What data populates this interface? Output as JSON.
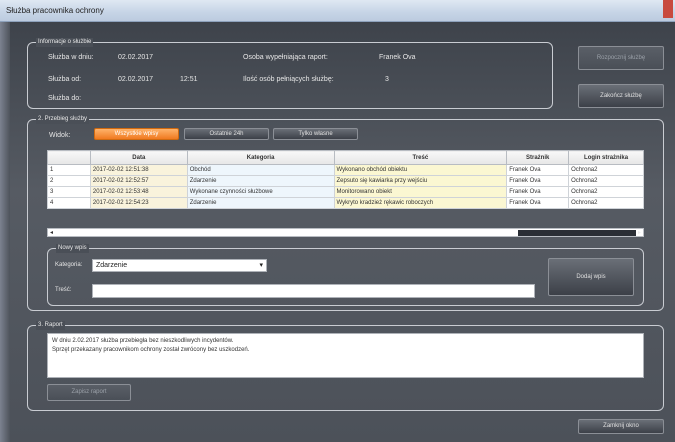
{
  "window": {
    "title": "Służba pracownika ochrony"
  },
  "service": {
    "group_label": "Informacje o służbie",
    "start_label": "Służba w dniu:",
    "start_value": "02.02.2017",
    "shift_label": "Służba od:",
    "shift_date": "02.02.2017",
    "shift_time": "12:51",
    "end_label": "Służba do:",
    "filler_label": "Osoba wypełniająca raport:",
    "filler_value": "Franek Ova",
    "count_label": "Ilość osób pełniących służbę:",
    "count_value": "3",
    "btn_start": "Rozpocznij służbę",
    "btn_end": "Zakończ służbę"
  },
  "journal": {
    "group_label": "2. Przebieg służby",
    "view_label": "Widok:",
    "filters": [
      "Wszystkie wpisy",
      "Ostatnie 24h",
      "Tylko własne"
    ],
    "columns": [
      "",
      "Data",
      "Kategoria",
      "Treść",
      "Strażnik",
      "Login strażnika"
    ],
    "rows": [
      {
        "no": "1",
        "date": "2017-02-02 12:51:38",
        "category": "Obchód",
        "content": "Wykonano obchód obiektu",
        "guard": "Franek Ova",
        "login": "Ochrona2"
      },
      {
        "no": "2",
        "date": "2017-02-02 12:52:57",
        "category": "Zdarzenie",
        "content": "Zepsuto się kawiarka przy wejściu",
        "guard": "Franek Ova",
        "login": "Ochrona2"
      },
      {
        "no": "3",
        "date": "2017-02-02 12:53:48",
        "category": "Wykonane czynności służbowe",
        "content": "Monitorowano obiekt",
        "guard": "Franek Ova",
        "login": "Ochrona2"
      },
      {
        "no": "4",
        "date": "2017-02-02 12:54:23",
        "category": "Zdarzenie",
        "content": "Wykryto kradzież rękawic roboczych",
        "guard": "Franek Ova",
        "login": "Ochrona2"
      }
    ]
  },
  "new_entry": {
    "group_label": "Nowy wpis",
    "category_label": "Kategoria:",
    "category_value": "Zdarzenie",
    "text_label": "Treść:",
    "btn_save": "Dodaj wpis"
  },
  "report": {
    "group_label": "3. Raport",
    "line1": "W dniu 2.02.2017 służba przebiegła bez nieszkodliwych incydentów.",
    "line2": "Sprzęt przekazany pracownikom ochrony został zwrócony bez uszkodzeń.",
    "btn_save_report": "Zapisz raport"
  },
  "footer": {
    "btn_close": "Zamknij okno"
  }
}
